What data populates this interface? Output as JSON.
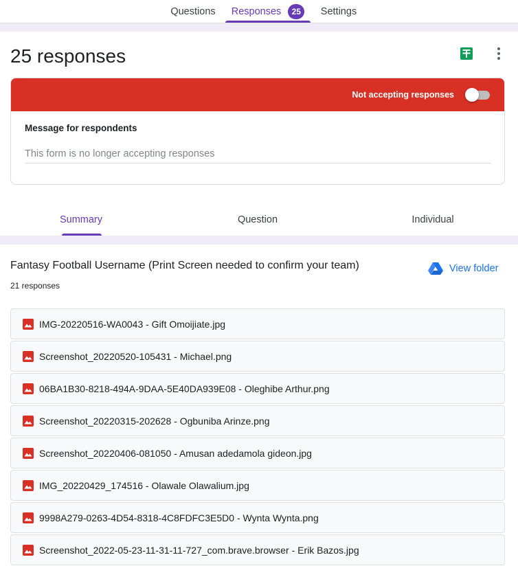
{
  "nav": {
    "tabs": [
      {
        "label": "Questions"
      },
      {
        "label": "Responses",
        "badge": "25"
      },
      {
        "label": "Settings"
      }
    ]
  },
  "summary": {
    "title": "25 responses",
    "accepting_label": "Not accepting responses",
    "accepting": false,
    "message_label": "Message for respondents",
    "message_value": "This form is no longer accepting responses"
  },
  "subtabs": [
    {
      "label": "Summary"
    },
    {
      "label": "Question"
    },
    {
      "label": "Individual"
    }
  ],
  "question": {
    "title": "Fantasy Football Username (Print Screen needed to confirm your team)",
    "response_count": "21 responses",
    "view_folder_label": "View folder",
    "files": [
      "IMG-20220516-WA0043 - Gift Omoijiate.jpg",
      "Screenshot_20220520-105431 - Michael.png",
      "06BA1B30-8218-494A-9DAA-5E40DA939E08 - Oleghibe Arthur.png",
      "Screenshot_20220315-202628 - Ogbuniba Arinze.png",
      "Screenshot_20220406-081050 - Amusan adedamola gideon.jpg",
      "IMG_20220429_174516 - Olawale Olawalium.jpg",
      "9998A279-0263-4D54-8318-4C8FDFC3E5D0 - Wynta Wynta.png",
      "Screenshot_2022-05-23-11-31-11-727_com.brave.browser - Erik Bazos.jpg"
    ]
  },
  "colors": {
    "accent": "#673ab7",
    "banner": "#d93025",
    "link": "#1a73e8",
    "sheets": "#0f9d58",
    "file_icon": "#d93025"
  },
  "icons": {
    "sheets": "google-sheets-icon",
    "more": "more-vert-icon",
    "folder": "google-drive-icon",
    "file": "image-file-icon"
  }
}
